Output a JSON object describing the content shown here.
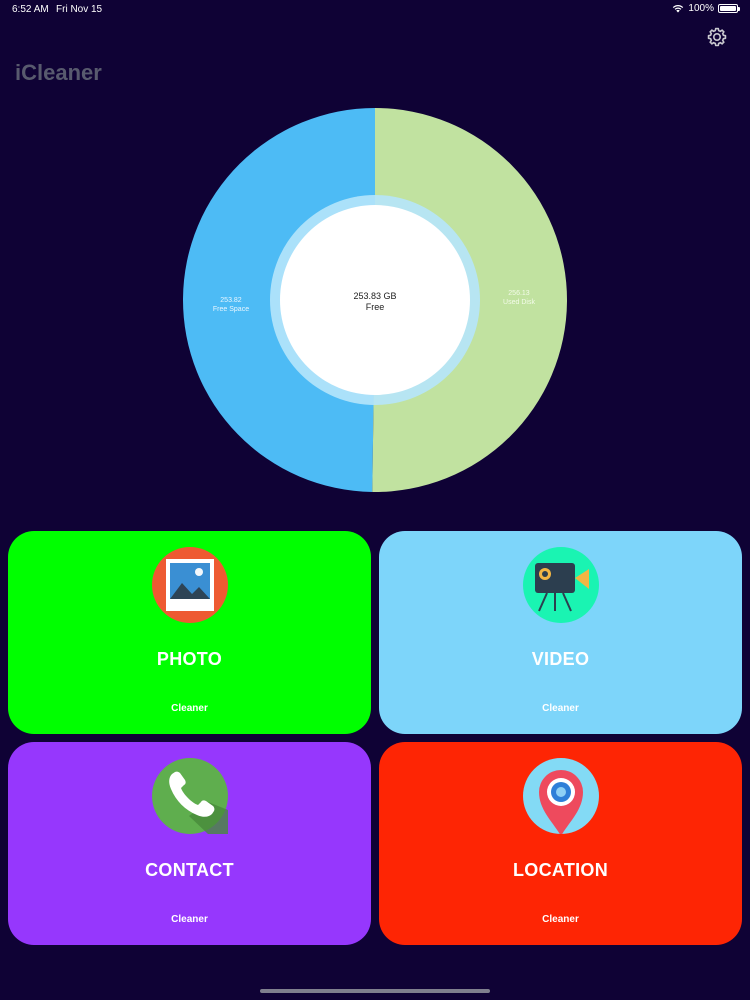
{
  "status_bar": {
    "time": "6:52 AM",
    "date": "Fri Nov 15",
    "battery": "100%"
  },
  "header": {
    "title": "iCleaner",
    "settings_icon": "gear-icon"
  },
  "storage_chart": {
    "center_value": "253.83 GB",
    "center_label": "Free",
    "free_value": "253.82",
    "free_label": "Free Space",
    "used_value": "256.13",
    "used_label": "Used Disk",
    "free_color": "#4dbbf5",
    "used_color": "#c1e2a0"
  },
  "chart_data": {
    "type": "pie",
    "categories": [
      "Free Space",
      "Used Disk"
    ],
    "values": [
      253.82,
      256.13
    ],
    "center_text": [
      "253.83 GB",
      "Free"
    ]
  },
  "tiles": [
    {
      "label": "PHOTO",
      "sub": "Cleaner",
      "color": "#00ff00",
      "icon": "photo-icon"
    },
    {
      "label": "VIDEO",
      "sub": "Cleaner",
      "color": "#7dd5fa",
      "icon": "video-camera-icon"
    },
    {
      "label": "CONTACT",
      "sub": "Cleaner",
      "color": "#9637fd",
      "icon": "phone-icon"
    },
    {
      "label": "LOCATION",
      "sub": "Cleaner",
      "color": "#fe2504",
      "icon": "location-pin-icon"
    }
  ]
}
